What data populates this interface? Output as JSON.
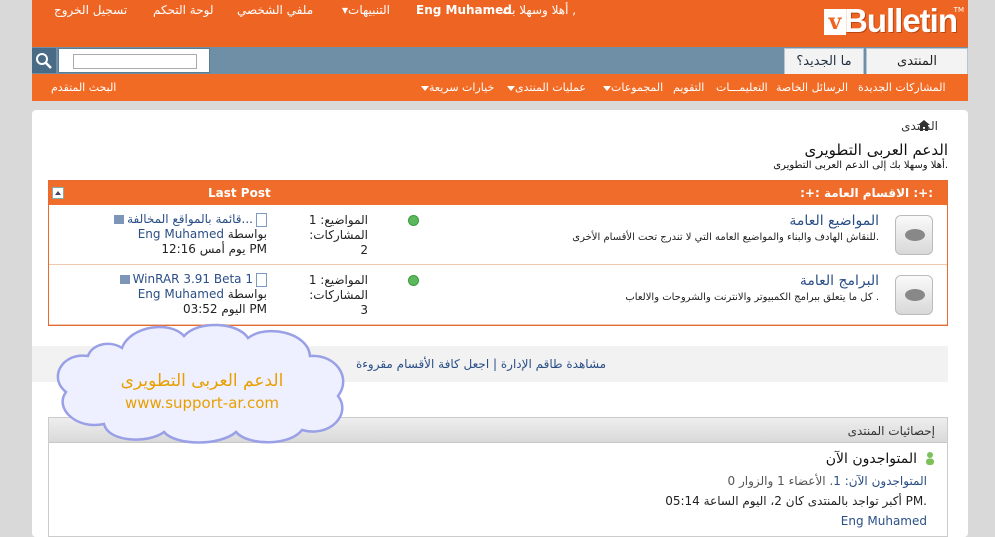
{
  "header": {
    "brand": "Bulletin",
    "brand_v": "v",
    "brand_tm": "TM",
    "welcome": "أهلا وسهلا بك ,",
    "username": "Eng Muhamed",
    "notifications": "التنبيهات",
    "profile": "ملفي الشخصي",
    "control_panel": "لوحة التحكم",
    "logout": "تسجيل الخروج"
  },
  "tabs": {
    "forum": "المنتدى",
    "whats_new": "ما الجديد؟"
  },
  "search": {
    "placeholder": ""
  },
  "subnav": {
    "new_posts": "المشاركات الجديدة",
    "private_messages": "الرسائل الخاصة",
    "faq": "التعليمـــات",
    "calendar": "التقويم",
    "groups": "المجموعات",
    "forum_actions": "عمليات المنتدى",
    "quick_links": "خيارات سريعة",
    "advanced_search": "البحث المتقدم"
  },
  "main": {
    "breadcrumb": "المنتدى",
    "title": "الدعم العربى التطويرى",
    "welcome_text": "أهلا وسهلا بك إلى الدعم العربى التطويرى."
  },
  "forum_table": {
    "category_title": ":+: الاقسام العامة :+:",
    "last_post_header": "Last Post",
    "rows": [
      {
        "name": "المواضيع العامة",
        "description": "للنقاش الهادف والبناء والمواضيع العامه التي لا تندرج تحت الأقسام الأخرى.",
        "threads": "المواضيع: 1",
        "posts": "المشاركات: 2",
        "lp_title": "قائمة بالمواقع المخالفة...",
        "lp_by": "بواسطة",
        "lp_user": "Eng Muhamed",
        "lp_time": "يوم أمس 12:16 PM"
      },
      {
        "name": "البرامج العامة",
        "description": "كل ما يتعلق ببرامج الكمبيوتر والانترنت والشروحات والالعاب .",
        "threads": "المواضيع: 1",
        "posts": "المشاركات: 3",
        "lp_title": "WinRAR 3.91 Beta 1",
        "lp_by": "بواسطة",
        "lp_user": "Eng Muhamed",
        "lp_time": "اليوم 03:52 PM"
      }
    ]
  },
  "links_bar": {
    "mark_read": "اجعل كافة الأقسام مقروءة",
    "separator": "|",
    "view_staff": "مشاهدة طاقم الإدارة"
  },
  "stats": {
    "title": "إحصائيات المنتدى",
    "online_title": "المتواجدون الآن",
    "online_label": "المتواجدون الآن:",
    "online_count": "1",
    "online_rest": ". الأعضاء 1 والزوار 0",
    "record": "أكبر تواجد بالمنتدى كان 2، اليوم الساعة 05:14 PM.",
    "online_user": "Eng Muhamed"
  },
  "overlay": {
    "line1": "الدعم العربى التطويرى",
    "line2": "www.support-ar.com"
  }
}
